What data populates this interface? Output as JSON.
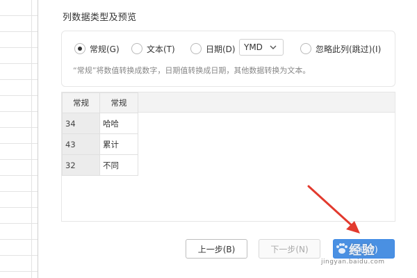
{
  "section_title": "列数据类型及预览",
  "radios": [
    {
      "label": "常规(G)",
      "checked": true
    },
    {
      "label": "文本(T)",
      "checked": false
    },
    {
      "label": "日期(D)",
      "checked": false
    },
    {
      "label": "忽略此列(跳过)(I)",
      "checked": false
    }
  ],
  "date_format": {
    "selected": "YMD"
  },
  "hint": "“常规”将数值转换成数字，日期值转换成日期，其他数据转换为文本。",
  "preview": {
    "headers": [
      "常规",
      "常规"
    ],
    "rows": [
      [
        "34",
        "哈哈"
      ],
      [
        "43",
        "累计"
      ],
      [
        "32",
        "不同"
      ]
    ]
  },
  "buttons": {
    "prev": "上一步(B)",
    "next": "下一步(N)",
    "finish": "完成(F)"
  },
  "colors": {
    "primary": "#4a90e2",
    "arrow": "#e23a2e"
  },
  "watermark": {
    "logo": "经验",
    "url": "jingyan.baidu.com"
  }
}
